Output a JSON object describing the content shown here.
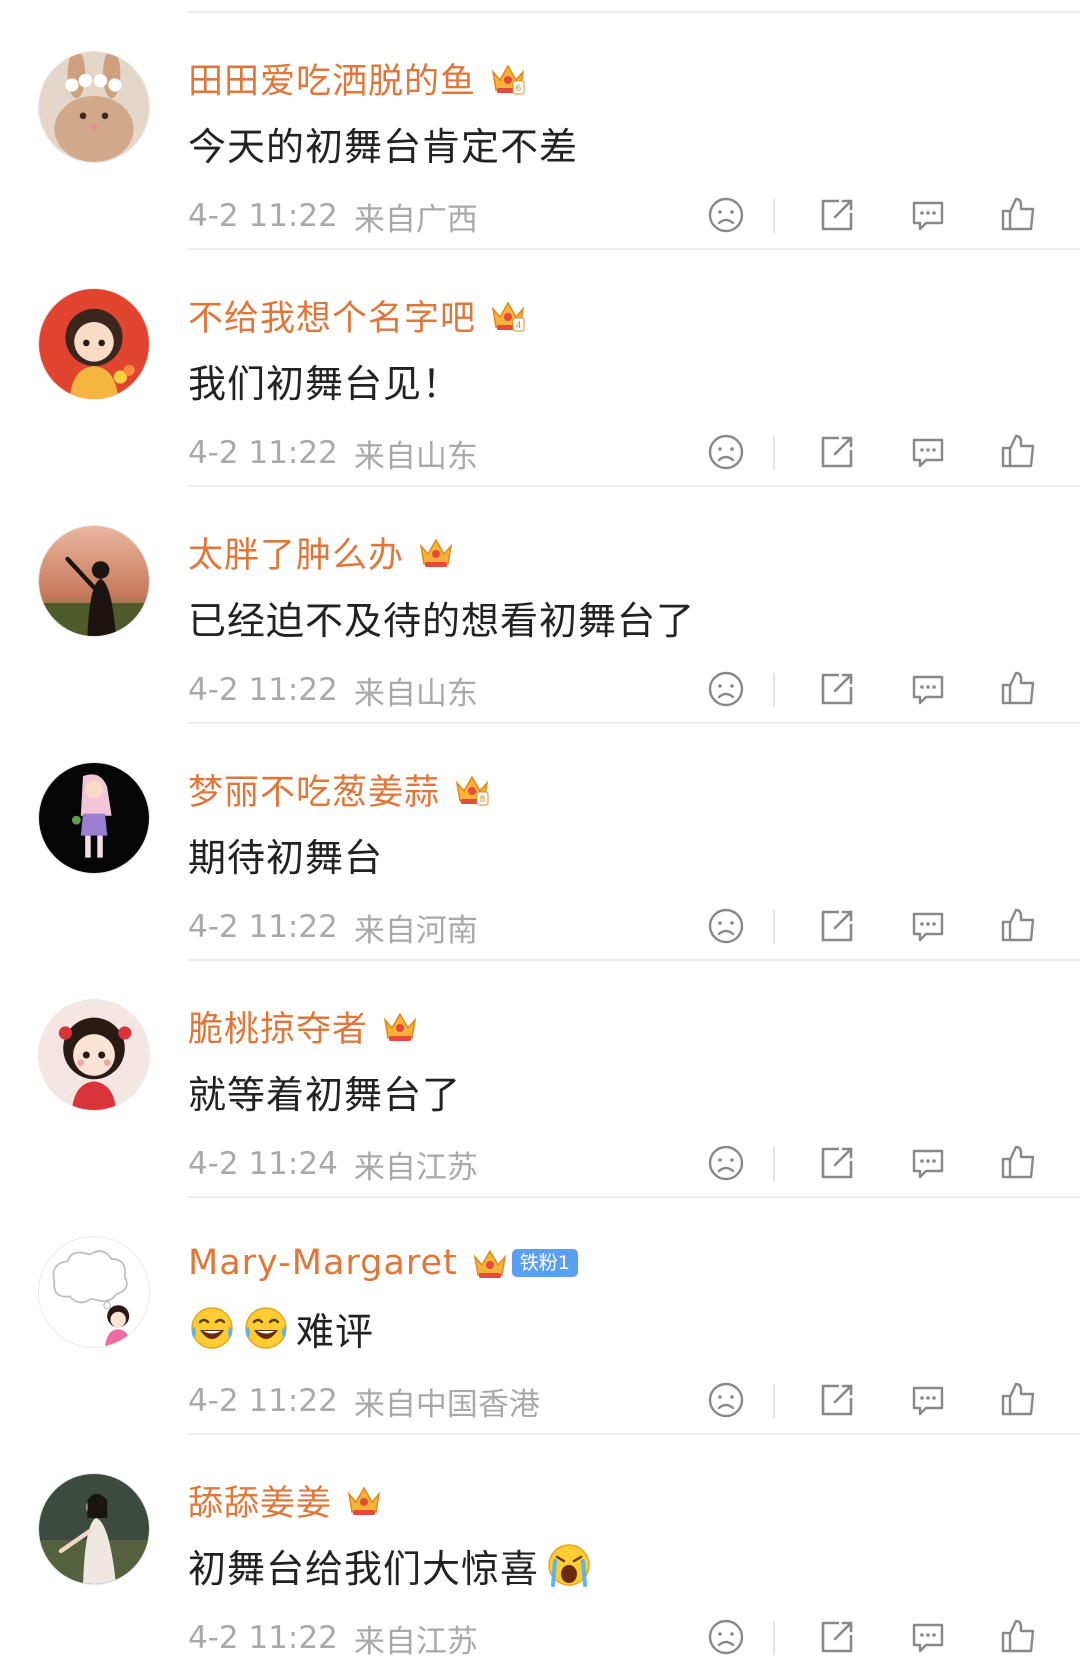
{
  "comments": [
    {
      "username": "田田爱吃洒脱的鱼",
      "crown_level": "6",
      "text": "今天的初舞台肯定不差",
      "time": "4-2 11:22",
      "location": "来自广西",
      "avatar_bg": "#d8c2ad",
      "avatar_icon": "rabbit-avatar"
    },
    {
      "username": "不给我想个名字吧",
      "crown_level": "4",
      "text": "我们初舞台见！",
      "time": "4-2 11:22",
      "location": "来自山东",
      "avatar_bg": "#e2452f",
      "avatar_icon": "cartoon-girl-avatar"
    },
    {
      "username": "太胖了肿么办",
      "crown_level": "",
      "text": "已经迫不及待的想看初舞台了",
      "time": "4-2 11:22",
      "location": "来自山东",
      "avatar_bg": "#c98a6a",
      "avatar_icon": "sunset-girl-avatar"
    },
    {
      "username": "梦丽不吃葱姜蒜",
      "crown_level": "8",
      "text": "期待初舞台",
      "time": "4-2 11:22",
      "location": "来自河南",
      "avatar_bg": "#050505",
      "avatar_icon": "dark-girl-avatar"
    },
    {
      "username": "脆桃掠夺者",
      "crown_level": "",
      "text": "就等着初舞台了",
      "time": "4-2 11:24",
      "location": "来自江苏",
      "avatar_bg": "#f4e6e2",
      "avatar_icon": "floral-girl-avatar"
    },
    {
      "username": "Mary-Margaret",
      "crown_level": "",
      "fan_badge": "铁粉1",
      "text": "难评",
      "emoji_before": [
        "laugh-cry-emoji",
        "laugh-cry-emoji"
      ],
      "time": "4-2 11:22",
      "location": "来自中国香港",
      "avatar_bg": "#ffffff",
      "avatar_icon": "thinking-girl-avatar"
    },
    {
      "username": "舔舔姜姜",
      "crown_level": "",
      "text": "初舞台给我们大惊喜",
      "emoji_after": [
        "screaming-cry-emoji"
      ],
      "time": "4-2 11:22",
      "location": "来自江苏",
      "avatar_bg": "#3c4a40",
      "avatar_icon": "white-dress-avatar"
    }
  ],
  "colors": {
    "username": "#e0773a",
    "content": "#222222",
    "meta": "#a9a9a9",
    "icon": "#888888",
    "fan_badge": "#5b9ff0"
  },
  "action_icons": [
    "dislike-icon",
    "share-icon",
    "comment-icon",
    "like-icon"
  ]
}
